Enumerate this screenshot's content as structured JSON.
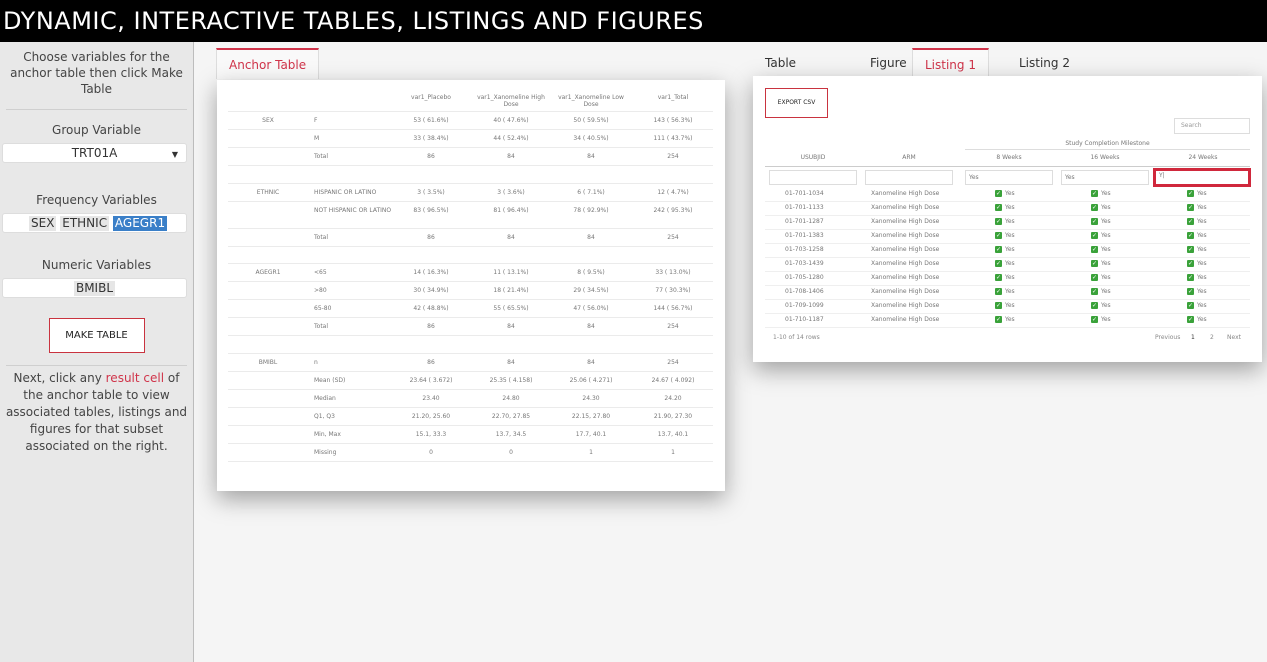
{
  "app": {
    "title": "DYNAMIC, INTERACTIVE TABLES, LISTINGS AND FIGURES"
  },
  "sidebar": {
    "intro": "Choose variables for the anchor table then click Make Table",
    "group_label": "Group Variable",
    "group_value": "TRT01A",
    "freq_label": "Frequency Variables",
    "freq_chips": [
      "SEX",
      "ETHNIC",
      "AGEGR1"
    ],
    "numeric_label": "Numeric Variables",
    "numeric_chips": [
      "BMIBL"
    ],
    "make_button": "MAKE TABLE",
    "outro_before": "Next, click any ",
    "outro_link": "result cell",
    "outro_after": " of the anchor table to view associated tables, listings and figures for that subset associated on the right.",
    "accent_color": "#d0344a"
  },
  "tabs_left": {
    "anchor": "Anchor Table"
  },
  "tabs_right": {
    "table": "Table",
    "figure": "Figure",
    "listing1": "Listing 1",
    "listing2": "Listing 2",
    "active": "Listing 1"
  },
  "anchor_table": {
    "headers": [
      "",
      "",
      "var1_Placebo",
      "var1_Xanomeline High Dose",
      "var1_Xanomeline Low Dose",
      "var1_Total"
    ],
    "rows": [
      [
        "SEX",
        "F",
        "53 ( 61.6%)",
        "40 ( 47.6%)",
        "50 ( 59.5%)",
        "143 ( 56.3%)"
      ],
      [
        "",
        "M",
        "33 ( 38.4%)",
        "44 ( 52.4%)",
        "34 ( 40.5%)",
        "111 ( 43.7%)"
      ],
      [
        "",
        "Total",
        "86",
        "84",
        "84",
        "254"
      ],
      [
        "",
        "",
        "",
        "",
        "",
        ""
      ],
      [
        "ETHNIC",
        "HISPANIC OR LATINO",
        "3 ( 3.5%)",
        "3 ( 3.6%)",
        "6 ( 7.1%)",
        "12 ( 4.7%)"
      ],
      [
        "",
        "NOT HISPANIC OR LATINO",
        "83 ( 96.5%)",
        "81 ( 96.4%)",
        "78 ( 92.9%)",
        "242 ( 95.3%)"
      ],
      [
        "",
        "Total",
        "86",
        "84",
        "84",
        "254"
      ],
      [
        "",
        "",
        "",
        "",
        "",
        ""
      ],
      [
        "AGEGR1",
        "<65",
        "14 ( 16.3%)",
        "11 ( 13.1%)",
        "8 ( 9.5%)",
        "33 ( 13.0%)"
      ],
      [
        "",
        ">80",
        "30 ( 34.9%)",
        "18 ( 21.4%)",
        "29 ( 34.5%)",
        "77 ( 30.3%)"
      ],
      [
        "",
        "65-80",
        "42 ( 48.8%)",
        "55 ( 65.5%)",
        "47 ( 56.0%)",
        "144 ( 56.7%)"
      ],
      [
        "",
        "Total",
        "86",
        "84",
        "84",
        "254"
      ],
      [
        "",
        "",
        "",
        "",
        "",
        ""
      ],
      [
        "BMIBL",
        "n",
        "86",
        "84",
        "84",
        "254"
      ],
      [
        "",
        "Mean (SD)",
        "23.64 ( 3.672)",
        "25.35 ( 4.158)",
        "25.06 ( 4.271)",
        "24.67 ( 4.092)"
      ],
      [
        "",
        "Median",
        "23.40",
        "24.80",
        "24.30",
        "24.20"
      ],
      [
        "",
        "Q1, Q3",
        "21.20, 25.60",
        "22.70, 27.85",
        "22.15, 27.80",
        "21.90, 27.30"
      ],
      [
        "",
        "Min, Max",
        "15.1, 33.3",
        "13.7, 34.5",
        "17.7, 40.1",
        "13.7, 40.1"
      ],
      [
        "",
        "Missing",
        "0",
        "0",
        "1",
        "1"
      ]
    ]
  },
  "listing": {
    "export_label": "EXPORT CSV",
    "search_placeholder": "Search",
    "group_header": "Study Completion Milestone",
    "columns": [
      "USUBJID",
      "ARM",
      "8 Weeks",
      "16 Weeks",
      "24 Weeks"
    ],
    "filters": [
      "",
      "",
      "Yes",
      "Yes",
      "Y|"
    ],
    "rows": [
      [
        "01-701-1034",
        "Xanomeline High Dose",
        "Yes",
        "Yes",
        "Yes"
      ],
      [
        "01-701-1133",
        "Xanomeline High Dose",
        "Yes",
        "Yes",
        "Yes"
      ],
      [
        "01-701-1287",
        "Xanomeline High Dose",
        "Yes",
        "Yes",
        "Yes"
      ],
      [
        "01-701-1383",
        "Xanomeline High Dose",
        "Yes",
        "Yes",
        "Yes"
      ],
      [
        "01-703-1258",
        "Xanomeline High Dose",
        "Yes",
        "Yes",
        "Yes"
      ],
      [
        "01-703-1439",
        "Xanomeline High Dose",
        "Yes",
        "Yes",
        "Yes"
      ],
      [
        "01-705-1280",
        "Xanomeline High Dose",
        "Yes",
        "Yes",
        "Yes"
      ],
      [
        "01-708-1406",
        "Xanomeline High Dose",
        "Yes",
        "Yes",
        "Yes"
      ],
      [
        "01-709-1099",
        "Xanomeline High Dose",
        "Yes",
        "Yes",
        "Yes"
      ],
      [
        "01-710-1187",
        "Xanomeline High Dose",
        "Yes",
        "Yes",
        "Yes"
      ]
    ],
    "footer_info": "1-10 of 14 rows",
    "pager": {
      "previous": "Previous",
      "pages": [
        "1",
        "2"
      ],
      "next": "Next"
    }
  }
}
